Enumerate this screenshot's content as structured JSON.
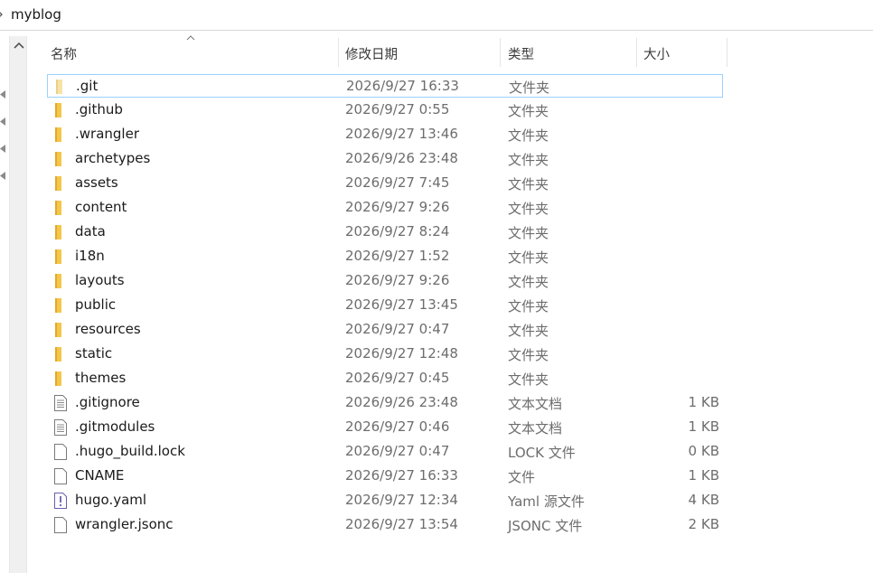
{
  "breadcrumb": {
    "path": "myblog"
  },
  "columns": {
    "name": "名称",
    "date": "修改日期",
    "type": "类型",
    "size": "大小"
  },
  "colors": {
    "folder": "#f5c64a",
    "selection_border": "#99d1ff",
    "muted_text": "#6d6d6d"
  },
  "files": [
    {
      "name": ".git",
      "date": "2026/9/27 16:33",
      "type": "文件夹",
      "size": "",
      "icon": "folder-pale-icon",
      "selected": true
    },
    {
      "name": ".github",
      "date": "2026/9/27 0:55",
      "type": "文件夹",
      "size": "",
      "icon": "folder-icon"
    },
    {
      "name": ".wrangler",
      "date": "2026/9/27 13:46",
      "type": "文件夹",
      "size": "",
      "icon": "folder-icon"
    },
    {
      "name": "archetypes",
      "date": "2026/9/26 23:48",
      "type": "文件夹",
      "size": "",
      "icon": "folder-icon"
    },
    {
      "name": "assets",
      "date": "2026/9/27 7:45",
      "type": "文件夹",
      "size": "",
      "icon": "folder-icon"
    },
    {
      "name": "content",
      "date": "2026/9/27 9:26",
      "type": "文件夹",
      "size": "",
      "icon": "folder-icon"
    },
    {
      "name": "data",
      "date": "2026/9/27 8:24",
      "type": "文件夹",
      "size": "",
      "icon": "folder-icon"
    },
    {
      "name": "i18n",
      "date": "2026/9/27 1:52",
      "type": "文件夹",
      "size": "",
      "icon": "folder-icon"
    },
    {
      "name": "layouts",
      "date": "2026/9/27 9:26",
      "type": "文件夹",
      "size": "",
      "icon": "folder-icon"
    },
    {
      "name": "public",
      "date": "2026/9/27 13:45",
      "type": "文件夹",
      "size": "",
      "icon": "folder-icon"
    },
    {
      "name": "resources",
      "date": "2026/9/27 0:47",
      "type": "文件夹",
      "size": "",
      "icon": "folder-icon"
    },
    {
      "name": "static",
      "date": "2026/9/27 12:48",
      "type": "文件夹",
      "size": "",
      "icon": "folder-icon"
    },
    {
      "name": "themes",
      "date": "2026/9/27 0:45",
      "type": "文件夹",
      "size": "",
      "icon": "folder-icon"
    },
    {
      "name": ".gitignore",
      "date": "2026/9/26 23:48",
      "type": "文本文档",
      "size": "1 KB",
      "icon": "text-document-icon"
    },
    {
      "name": ".gitmodules",
      "date": "2026/9/27 0:46",
      "type": "文本文档",
      "size": "1 KB",
      "icon": "text-document-icon"
    },
    {
      "name": ".hugo_build.lock",
      "date": "2026/9/27 0:47",
      "type": "LOCK 文件",
      "size": "0 KB",
      "icon": "blank-file-icon"
    },
    {
      "name": "CNAME",
      "date": "2026/9/27 16:33",
      "type": "文件",
      "size": "1 KB",
      "icon": "blank-file-icon"
    },
    {
      "name": "hugo.yaml",
      "date": "2026/9/27 12:34",
      "type": "Yaml 源文件",
      "size": "4 KB",
      "icon": "yaml-file-icon"
    },
    {
      "name": "wrangler.jsonc",
      "date": "2026/9/27 13:54",
      "type": "JSONC 文件",
      "size": "2 KB",
      "icon": "blank-file-icon"
    }
  ]
}
